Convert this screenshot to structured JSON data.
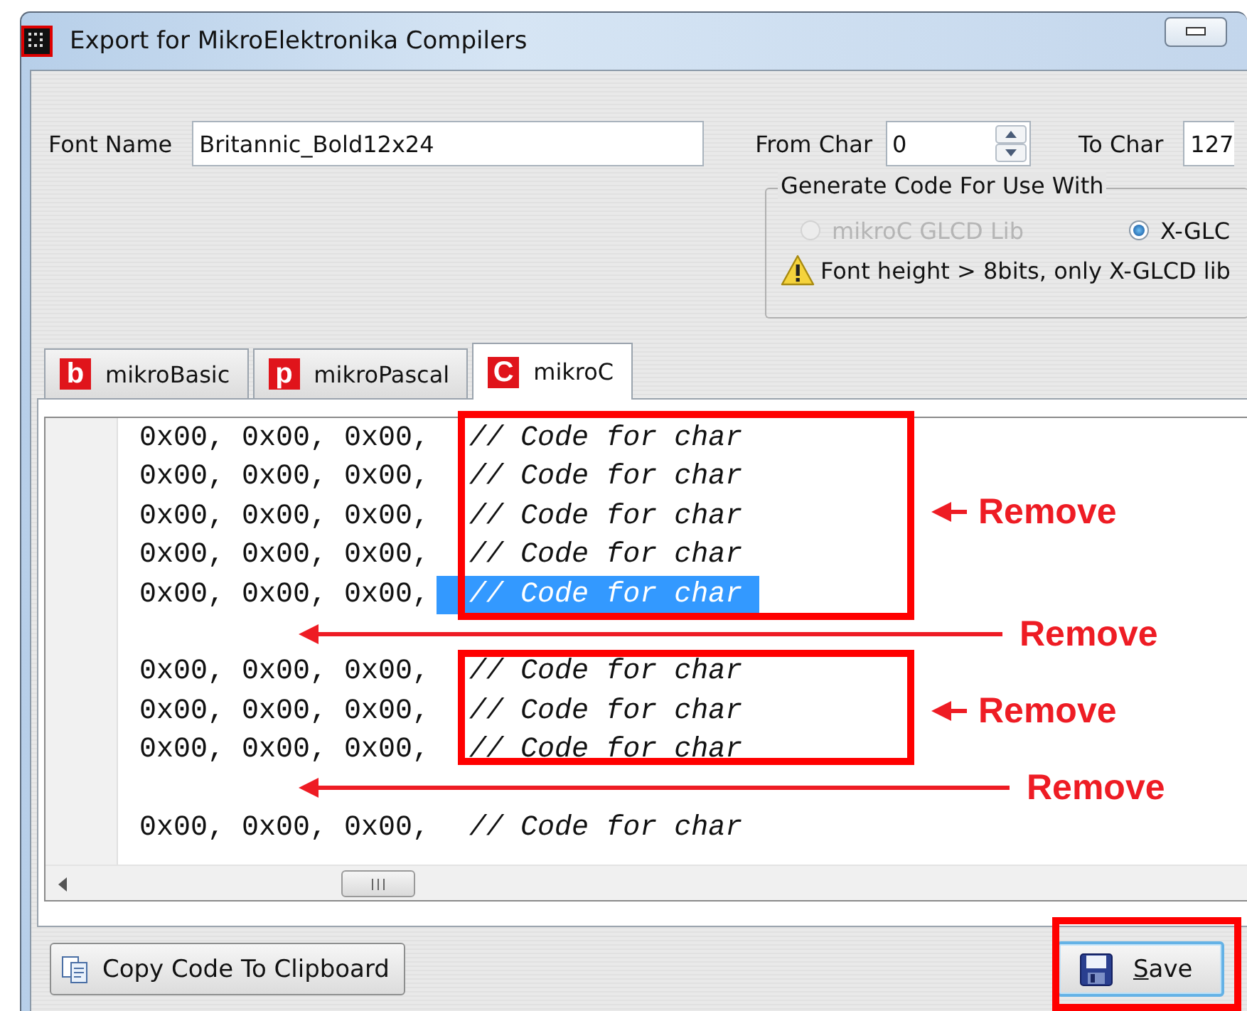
{
  "window": {
    "title": "Export for MikroElektronika Compilers"
  },
  "form": {
    "font_name": {
      "label": "Font Name",
      "value": "Britannic_Bold12x24"
    },
    "from_char": {
      "label": "From Char",
      "value": "0"
    },
    "to_char": {
      "label": "To Char",
      "value": "127"
    }
  },
  "generate_group": {
    "title": "Generate Code For Use With",
    "options": [
      {
        "label": "mikroC GLCD Lib",
        "selected": false,
        "disabled": true
      },
      {
        "label": "X-GLC",
        "selected": true,
        "disabled": false
      }
    ],
    "warning": "Font height > 8bits, only X-GLCD lib"
  },
  "tabs": [
    {
      "logo": "b",
      "label": "mikroBasic",
      "selected": false
    },
    {
      "logo": "p",
      "label": "mikroPascal",
      "selected": false
    },
    {
      "logo": "C",
      "label": "mikroC",
      "selected": true
    }
  ],
  "code_lines": [
    {
      "kind": "code",
      "code": "0x00, 0x00, 0x00,",
      "comment": "// Code for char",
      "selected": false
    },
    {
      "kind": "code",
      "code": "0x00, 0x00, 0x00,",
      "comment": "// Code for char",
      "selected": false
    },
    {
      "kind": "code",
      "code": "0x00, 0x00, 0x00,",
      "comment": "// Code for char",
      "selected": false
    },
    {
      "kind": "code",
      "code": "0x00, 0x00, 0x00,",
      "comment": "// Code for char",
      "selected": false
    },
    {
      "kind": "code",
      "code": "0x00, 0x00, 0x00,",
      "comment": "// Code for char",
      "selected": true
    },
    {
      "kind": "blank"
    },
    {
      "kind": "code",
      "code": "0x00, 0x00, 0x00,",
      "comment": "// Code for char",
      "selected": false
    },
    {
      "kind": "code",
      "code": "0x00, 0x00, 0x00,",
      "comment": "// Code for char",
      "selected": false
    },
    {
      "kind": "code",
      "code": "0x00, 0x00, 0x00,",
      "comment": "// Code for char",
      "selected": false
    },
    {
      "kind": "blank"
    },
    {
      "kind": "code",
      "code": "0x00, 0x00, 0x00,",
      "comment": "// Code for char",
      "selected": false
    }
  ],
  "buttons": [
    {
      "kind": "copy",
      "label": "Copy Code To Clipboard",
      "focused": false
    },
    {
      "kind": "save",
      "label": "Save",
      "focused": true
    }
  ],
  "annotations": [
    {
      "kind": "box"
    },
    {
      "kind": "arrow",
      "label": "Remove"
    },
    {
      "kind": "arrow",
      "label": "Remove"
    },
    {
      "kind": "box"
    },
    {
      "kind": "arrow",
      "label": "Remove"
    },
    {
      "kind": "arrow",
      "label": "Remove"
    },
    {
      "kind": "box"
    }
  ]
}
